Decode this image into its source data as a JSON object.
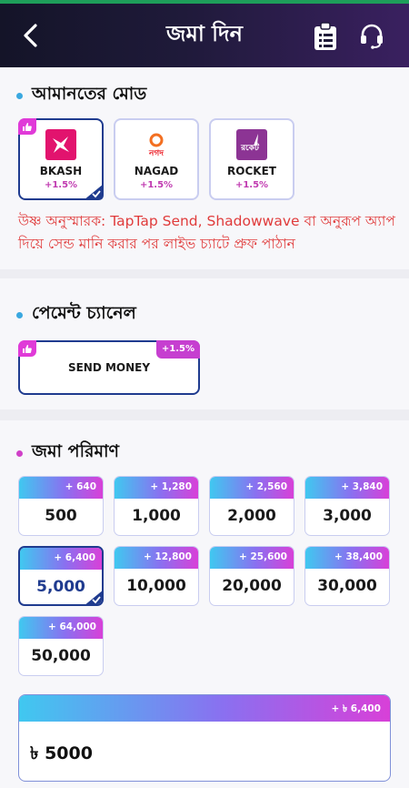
{
  "header": {
    "title": "জমা দিন",
    "back_icon": "chevron-left-icon",
    "clipboard_icon": "clipboard-list-icon",
    "support_icon": "headset-icon"
  },
  "deposit_mode": {
    "title": "আমানতের মোড",
    "options": [
      {
        "name": "BKASH",
        "bonus": "+1.5%",
        "selected": true,
        "recommended": true,
        "color": "#e2136e"
      },
      {
        "name": "NAGAD",
        "bonus": "+1.5%",
        "selected": false,
        "recommended": false,
        "color": "#ec1c24"
      },
      {
        "name": "ROCKET",
        "bonus": "+1.5%",
        "selected": false,
        "recommended": false,
        "color": "#8c3494"
      }
    ],
    "nagad_logo_text": "নগদ",
    "rocket_logo_text": "রকেট",
    "reminder": "উষ্ণ অনুস্মারক: TapTap Send, Shadowwave বা অনুরূপ অ্যাপ দিয়ে সেন্ড মানি করার পর লাইভ চ্যাটে প্রুফ পাঠান"
  },
  "payment_channel": {
    "title": "পেমেন্ট চ্যানেল",
    "option": {
      "label": "SEND MONEY",
      "bonus": "+1.5%",
      "selected": true
    }
  },
  "deposit_amount": {
    "title": "জমা পরিমাণ",
    "options": [
      {
        "value": "500",
        "bonus": "+ 640"
      },
      {
        "value": "1,000",
        "bonus": "+ 1,280"
      },
      {
        "value": "2,000",
        "bonus": "+ 2,560"
      },
      {
        "value": "3,000",
        "bonus": "+ 3,840"
      },
      {
        "value": "5,000",
        "bonus": "+ 6,400",
        "selected": true
      },
      {
        "value": "10,000",
        "bonus": "+ 12,800"
      },
      {
        "value": "20,000",
        "bonus": "+ 25,600"
      },
      {
        "value": "30,000",
        "bonus": "+ 38,400"
      },
      {
        "value": "50,000",
        "bonus": "+ 64,000"
      }
    ],
    "total_bonus": "+ ৳ 6,400",
    "total_amount": "৳  5000"
  },
  "colors": {
    "accent": "#1f3b8f",
    "pink": "#e03ad8",
    "reminder": "#e03b3b",
    "dot_blue": "#3aa8e0",
    "dot_pink": "#d040c8"
  }
}
